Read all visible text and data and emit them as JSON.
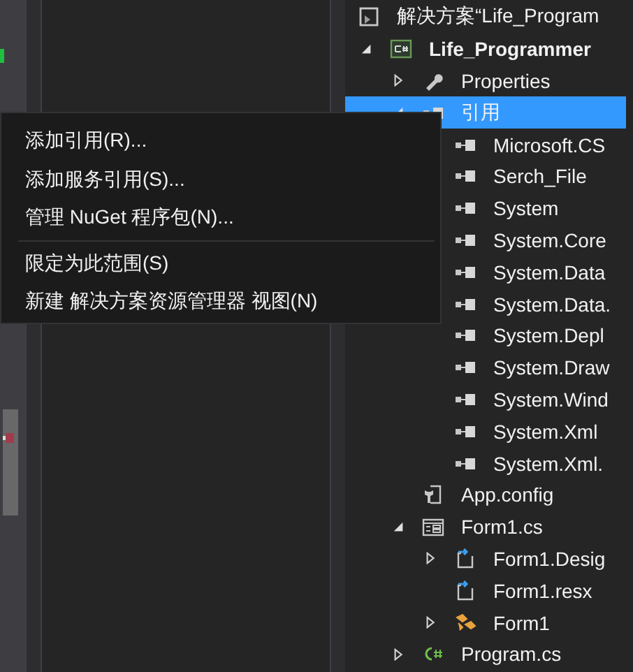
{
  "solution_explorer": {
    "tree": [
      {
        "label": "解决方案“Life_Program",
        "kind": "solution",
        "selected": false,
        "children": [
          {
            "label": "Life_Programmer",
            "kind": "project",
            "bold": true,
            "expanded": true,
            "selected": false,
            "children": [
              {
                "label": "Properties",
                "kind": "properties",
                "expanded": false,
                "selected": false
              },
              {
                "label": "引用",
                "kind": "references",
                "expanded": true,
                "selected": true,
                "children": [
                  {
                    "label": "Microsoft.CS",
                    "kind": "reference",
                    "selected": false
                  },
                  {
                    "label": "Serch_File",
                    "kind": "reference",
                    "selected": false
                  },
                  {
                    "label": "System",
                    "kind": "reference",
                    "selected": false
                  },
                  {
                    "label": "System.Core",
                    "kind": "reference",
                    "selected": false
                  },
                  {
                    "label": "System.Data",
                    "kind": "reference",
                    "selected": false
                  },
                  {
                    "label": "System.Data.",
                    "kind": "reference",
                    "selected": false
                  },
                  {
                    "label": "System.Depl",
                    "kind": "reference",
                    "selected": false
                  },
                  {
                    "label": "System.Draw",
                    "kind": "reference",
                    "selected": false
                  },
                  {
                    "label": "System.Wind",
                    "kind": "reference",
                    "selected": false
                  },
                  {
                    "label": "System.Xml",
                    "kind": "reference",
                    "selected": false
                  },
                  {
                    "label": "System.Xml.",
                    "kind": "reference",
                    "selected": false
                  }
                ]
              },
              {
                "label": "App.config",
                "kind": "config",
                "selected": false
              },
              {
                "label": "Form1.cs",
                "kind": "form",
                "expanded": true,
                "selected": false,
                "children": [
                  {
                    "label": "Form1.Desig",
                    "kind": "codefile",
                    "expanded": false,
                    "selected": false
                  },
                  {
                    "label": "Form1.resx",
                    "kind": "codefile",
                    "selected": false
                  },
                  {
                    "label": "Form1",
                    "kind": "class",
                    "expanded": false,
                    "selected": false
                  }
                ]
              },
              {
                "label": "Program.cs",
                "kind": "csfile",
                "expanded": false,
                "selected": false
              }
            ]
          }
        ]
      }
    ]
  },
  "context_menu": {
    "groups": [
      [
        "添加引用(R)...",
        "添加服务引用(S)...",
        "管理 NuGet 程序包(N)..."
      ],
      [
        "限定为此范围(S)",
        "新建 解决方案资源管理器 视图(N)"
      ]
    ]
  }
}
